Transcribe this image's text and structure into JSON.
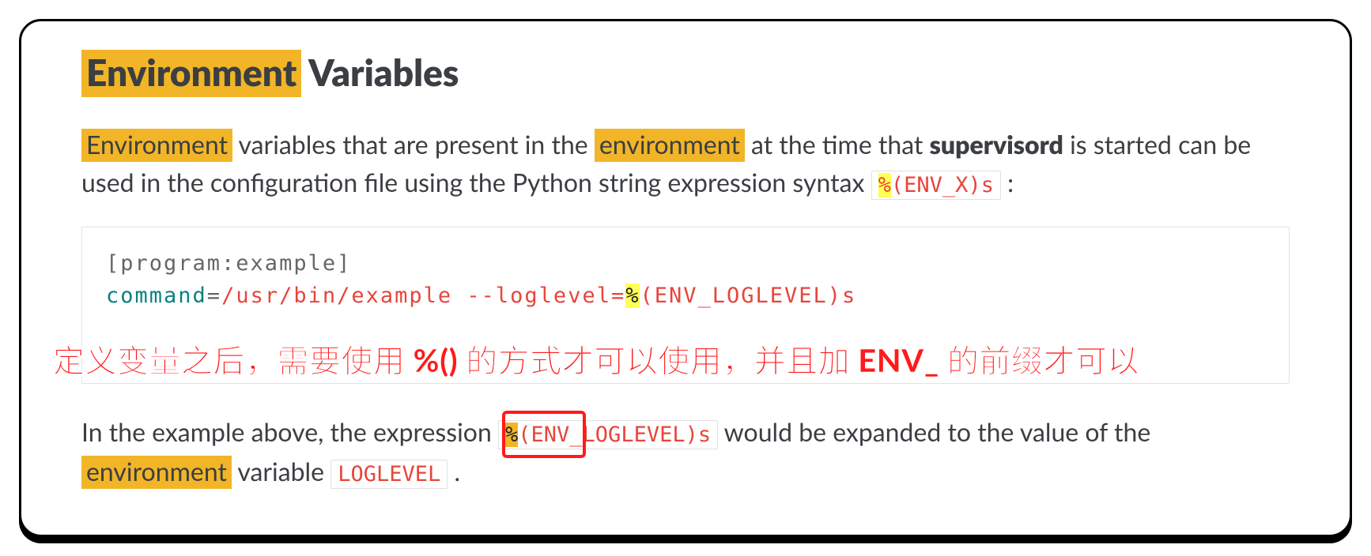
{
  "heading": {
    "highlighted": "Environment",
    "rest": " Variables"
  },
  "intro": {
    "hl1": "Environment",
    "t1": " variables that are present in the ",
    "hl2": "environment",
    "t2": " at the time that ",
    "bold": "supervisord",
    "t3": " is started can be used in the configuration file using the Python string expression syntax ",
    "code_pct": "%",
    "code_rest": "(ENV_X)s",
    "t4": " :"
  },
  "code": {
    "line1": "[program:example]",
    "line2_cmd": "command",
    "line2_eq": "=",
    "line2_path": "/usr/bin/example --loglevel=",
    "line2_pct": "%",
    "line2_expr": "(ENV_LOGLEVEL)s"
  },
  "annotation": "定义变量之后，需要使用 %() 的方式才可以使用，并且加 ENV_ 的前缀才可以",
  "outro": {
    "t1": "In the example above, the expression ",
    "code_pct": "%",
    "code_boxed": "(ENV_",
    "code_rest": "LOGLEVEL)s",
    "t2": " would be expanded to the value of the ",
    "hl1": "environment",
    "t3": " variable ",
    "code_var": "LOGLEVEL",
    "t4": " ."
  }
}
